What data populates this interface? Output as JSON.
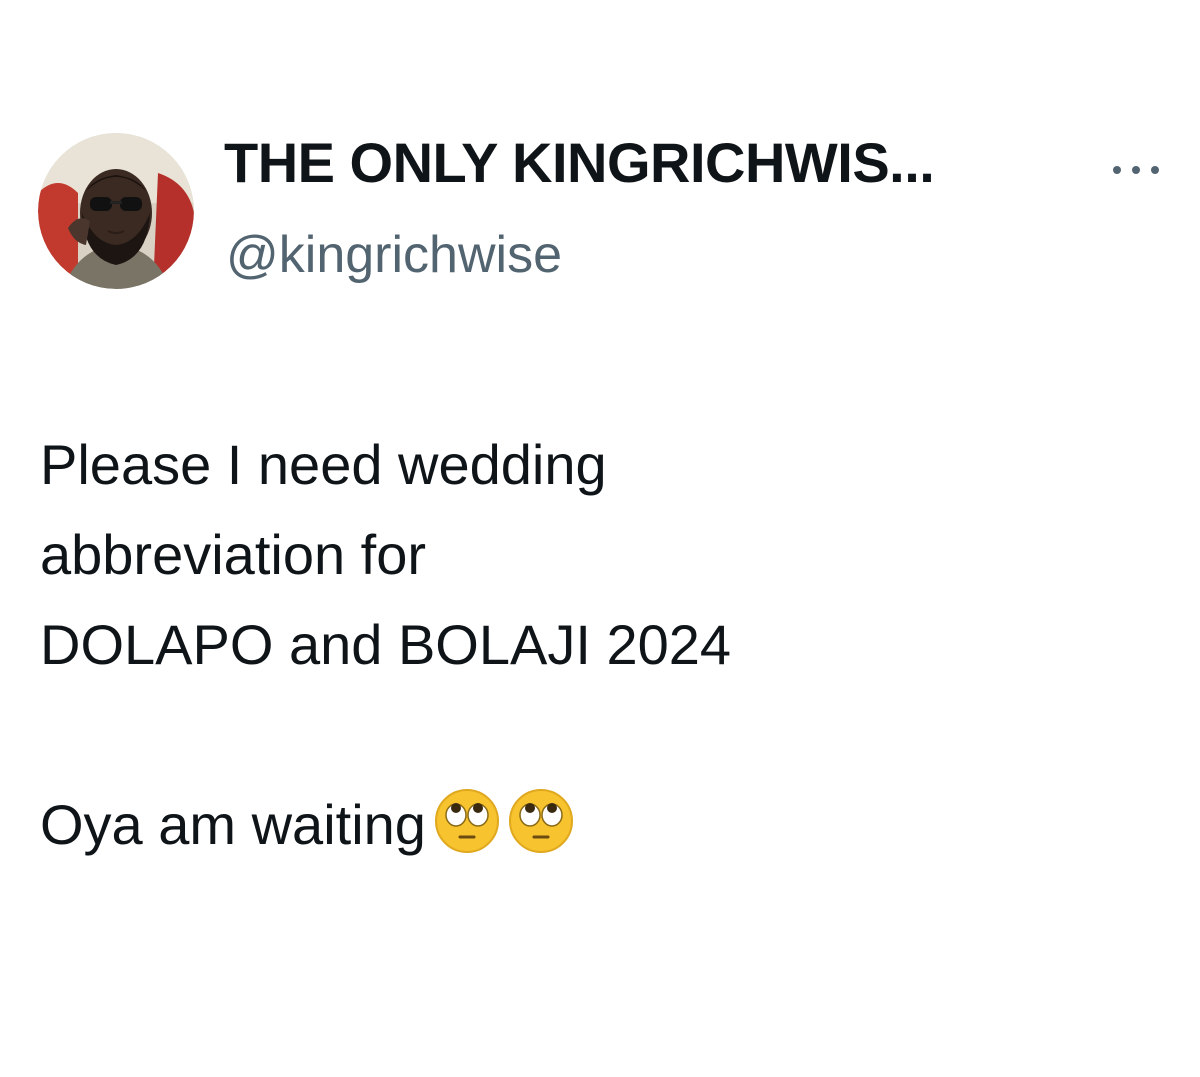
{
  "tweet": {
    "author": {
      "display_name": "THE ONLY KINGRICHWIS...",
      "handle": "@kingrichwise",
      "avatar_icon": "profile-photo"
    },
    "more_icon": "ellipsis-icon",
    "text_lines": [
      "Please I need wedding",
      "abbreviation for",
      "DOLAPO  and BOLAJI  2024"
    ],
    "followup_text": "Oya am waiting",
    "emojis": [
      "face-with-rolling-eyes-icon",
      "face-with-rolling-eyes-icon"
    ]
  }
}
